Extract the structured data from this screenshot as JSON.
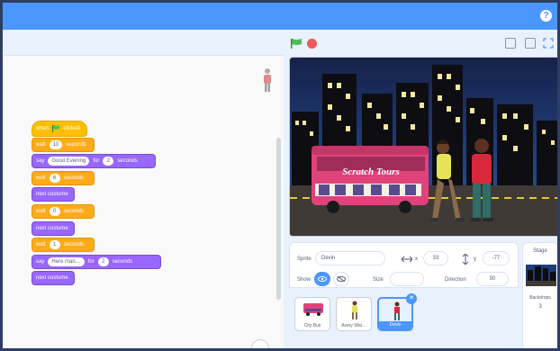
{
  "menubar": {
    "help_glyph": "?"
  },
  "stage_controls": {
    "green_flag": "green-flag-icon",
    "stop": "stop-icon",
    "views": [
      "small-stage-icon",
      "normal-stage-icon",
      "fullscreen-icon"
    ]
  },
  "scripts": [
    {
      "category": "events",
      "parts": [
        "when",
        "clicked"
      ]
    },
    {
      "category": "control",
      "parts": [
        "wait",
        "10",
        "seconds"
      ]
    },
    {
      "category": "looks",
      "parts": [
        "say",
        "Good Evening",
        "for",
        "2",
        "seconds"
      ]
    },
    {
      "category": "control",
      "parts": [
        "wait",
        "6",
        "seconds"
      ]
    },
    {
      "category": "looks",
      "parts": [
        "next costume"
      ]
    },
    {
      "category": "control",
      "parts": [
        "wait",
        "0",
        "seconds"
      ]
    },
    {
      "category": "looks",
      "parts": [
        "next costume"
      ]
    },
    {
      "category": "control",
      "parts": [
        "wait",
        "1",
        "seconds"
      ]
    },
    {
      "category": "looks",
      "parts": [
        "say",
        "Here man…",
        "for",
        "2",
        "seconds"
      ]
    },
    {
      "category": "looks",
      "parts": [
        "next costume"
      ]
    }
  ],
  "stage": {
    "bus_text": "Scratch Tours"
  },
  "sprite_info": {
    "sprite_label": "Sprite",
    "sprite_name": "Devin",
    "x_label": "x",
    "x_value": "33",
    "y_label": "y",
    "y_value": "-77",
    "show_label": "Show",
    "size_label": "Size",
    "size_value": "",
    "direction_label": "Direction",
    "direction_value": "90"
  },
  "sprites": [
    {
      "name": "City Bus",
      "selected": false
    },
    {
      "name": "Avery Wal…",
      "selected": false
    },
    {
      "name": "Devin",
      "selected": true
    }
  ],
  "stage_panel": {
    "title": "Stage",
    "backdrops_label": "Backdrops",
    "backdrops_count": "3"
  },
  "colors": {
    "menubar": "#4c97ff",
    "events": "#ffbf00",
    "control": "#ffab19",
    "looks": "#9966ff"
  }
}
